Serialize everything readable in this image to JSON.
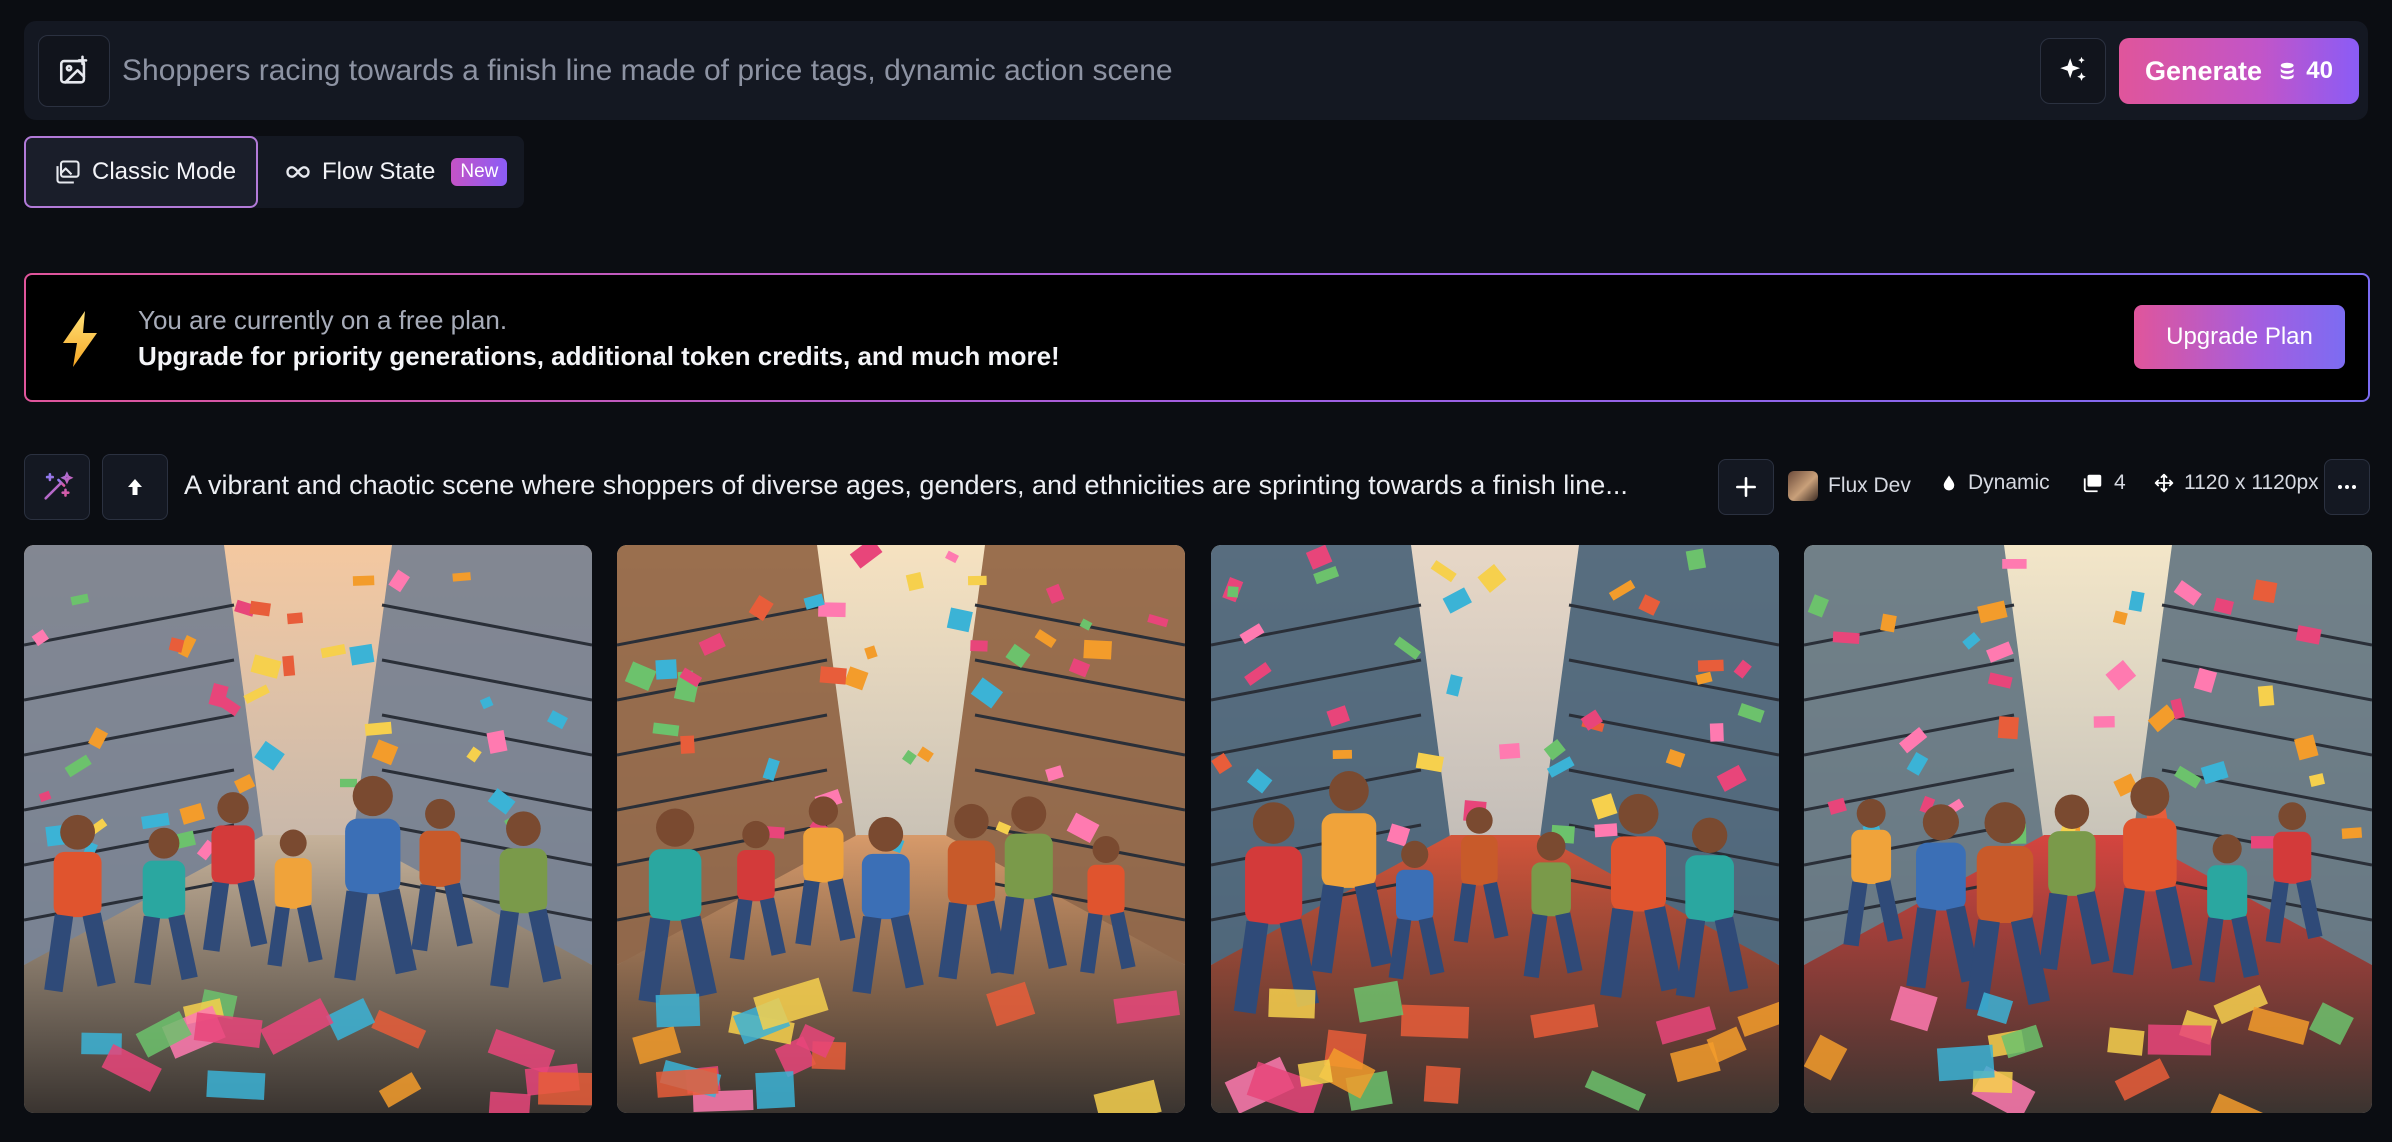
{
  "prompt_bar": {
    "placeholder": "Shoppers racing towards a finish line made of price tags, dynamic action scene",
    "image_button_icon": "image-plus-icon",
    "enhance_icon": "sparkles-icon",
    "generate_label": "Generate",
    "token_icon": "coins-icon",
    "token_cost": "40"
  },
  "modes": {
    "classic_label": "Classic Mode",
    "flow_label": "Flow State",
    "new_badge": "New",
    "active": "Classic Mode"
  },
  "banner": {
    "line1": "You are currently on a free plan.",
    "line2": "Upgrade for priority generations, additional token credits, and much more!",
    "button": "Upgrade Plan",
    "icon": "lightning-bolt-icon"
  },
  "generation": {
    "prompt": "A vibrant and chaotic scene where shoppers of diverse ages, genders, and ethnicities are sprinting towards a finish line...",
    "model": "Flux Dev",
    "style": "Dynamic",
    "image_count": "4",
    "dimensions": "1120 x 1120px"
  },
  "images": [
    {
      "alt": "shoppers racing image 1",
      "palette": [
        "#f4c8a0",
        "#6e7b8f",
        "#c6b29a"
      ]
    },
    {
      "alt": "shoppers racing image 2",
      "palette": [
        "#f6e2c0",
        "#8a5a3a",
        "#d79a6a"
      ]
    },
    {
      "alt": "shoppers racing image 3",
      "palette": [
        "#e7d7c6",
        "#3e5a72",
        "#d2543a"
      ]
    },
    {
      "alt": "shoppers racing image 4",
      "palette": [
        "#f3e6c8",
        "#5a6f7c",
        "#d5453f"
      ]
    }
  ],
  "colors": {
    "background": "#0b0d12",
    "accent_pink": "#e0559b",
    "accent_purple": "#8a5cf6"
  }
}
